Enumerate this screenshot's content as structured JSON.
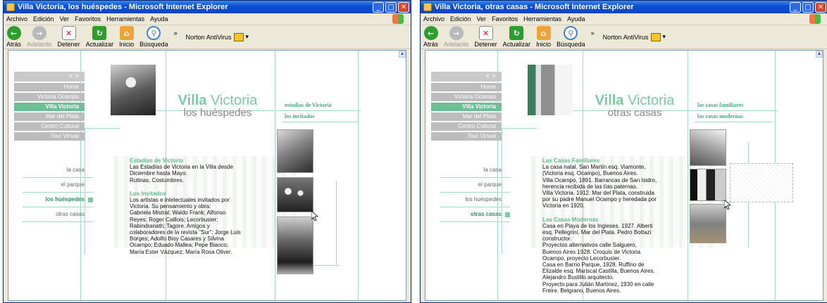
{
  "toolbar_labels": {
    "back": "Atrás",
    "forward": "Adelante",
    "stop": "Detener",
    "refresh": "Actualizar",
    "home": "Inicio",
    "search": "Búsqueda",
    "more": "»",
    "norton": "Norton AntiVirus"
  },
  "menu": [
    "Archivo",
    "Edición",
    "Ver",
    "Favoritos",
    "Herramientas",
    "Ayuda"
  ],
  "nav_arrows": "< >",
  "main_nav": [
    "Home",
    "Victoria Ocampo",
    "Villa Victoria",
    "Mar del Plata",
    "Centro Cultural",
    "Tour Virtual"
  ],
  "sub_nav": [
    "la casa",
    "el parque",
    "los huéspedes",
    "otras casas"
  ],
  "left_window": {
    "title": "Villa Victoria, los huéspedes - Microsoft Internet Explorer",
    "brand_bold": "Villa",
    "brand_rest": " Victoria",
    "subtitle": "los huéspedes",
    "right_links": [
      "estadías de Victoria",
      "los invitados"
    ],
    "sections": [
      {
        "title": "Estadías de Victoria",
        "text": "Las Estadías de Victoria en la Villa desde\nDiciembre hasta Mayo.\nRutinas, Costumbres."
      },
      {
        "title": "Los Invitados",
        "text": "Los artistas e intelectuales invitados por\nVictoria. Su pensamiento y obra:\nGabriela Mistral; Waldo Frank; Alfonso\nReyes; Roger Caillois; Lecorbusier;\nRabindranath; Tagore. Amigos y\ncolaboradores de la revista \"Sur\": Jorge Luis\nBorges; Adolfo Bioy Casares y Silvina\nOcampo; Eduado Mallea; Pepe Bianco;\nMaría Ester Vázquez; María Rosa Oliver."
      }
    ]
  },
  "right_window": {
    "title": "Villa Victoria, otras casas - Microsoft Internet Explorer",
    "brand_bold": "Villa",
    "brand_rest": " Victoria",
    "subtitle": "otras casas",
    "right_links": [
      "las casas familiares",
      "las casas modernas"
    ],
    "sections": [
      {
        "title": "Las Casas Familiares",
        "text": "La casa natal. San Martín esq. Viamonte,\n(Victoria esq. Ocampo), Buenos Aires.\nVilla Ocampo, 1891. Barrancas de San Isidro,\nherencia recibida de las tías paternas.\nVilla Victoria. 1912. Mar del Plata, construida\npor su padre Manuel Ocampo y heredada por\nVictoria en 1920."
      },
      {
        "title": "Las Casas Modernas",
        "text": "Casa en Playa de los Ingleses. 1927. Alberti\nesq. Pellegrini, Mar del Plata. Pedro Bottazi\nconstructor.\nProyectos alternativos calle Salguero,\nBuenos Aires 1928. Croquis de Victoria\nOcampo, proyecto Lecorbusier.\nCasa en Barrio Parque, 1928. Ruffino de\nElizalde esq. Mariscal Castilla, Buenos Aires.\nAlejandro Bustillo arquitecto.\nProyecto para Julián Martínez, 1930 en calle\nFreire. Belgrano, Buenos Aires."
      }
    ]
  },
  "colors": {
    "accent_green": "#7cc9a2",
    "nav_gray": "#bdbdbd",
    "xp_blue": "#0a4fd8"
  }
}
